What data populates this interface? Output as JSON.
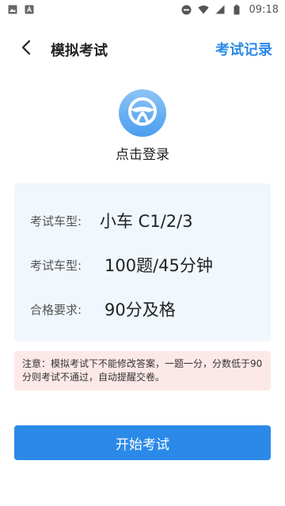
{
  "status_bar": {
    "time": "09:18",
    "left_icons": [
      "image-icon",
      "text-icon"
    ],
    "right_icons": [
      "do-not-disturb-icon",
      "wifi-icon",
      "signal-icon",
      "battery-icon"
    ]
  },
  "nav": {
    "title": "模拟考试",
    "record_link": "考试记录",
    "back_icon": "chevron-left-icon"
  },
  "profile": {
    "avatar_icon": "steering-wheel-icon",
    "login_label": "点击登录"
  },
  "info": {
    "rows": [
      {
        "label": "考试车型:",
        "value": "小车 C1/2/3"
      },
      {
        "label": "考试车型:",
        "value": "100题/45分钟"
      },
      {
        "label": "合格要求:",
        "value": "90分及格"
      }
    ]
  },
  "notice": {
    "text": "注意：模拟考试下不能修改答案，一题一分，分数低于90分则考试不通过，自动提醒交卷。"
  },
  "actions": {
    "start_label": "开始考试"
  },
  "colors": {
    "accent": "#2b8ae8",
    "card_bg": "#f0f7fd",
    "notice_bg": "#fde8e8"
  }
}
